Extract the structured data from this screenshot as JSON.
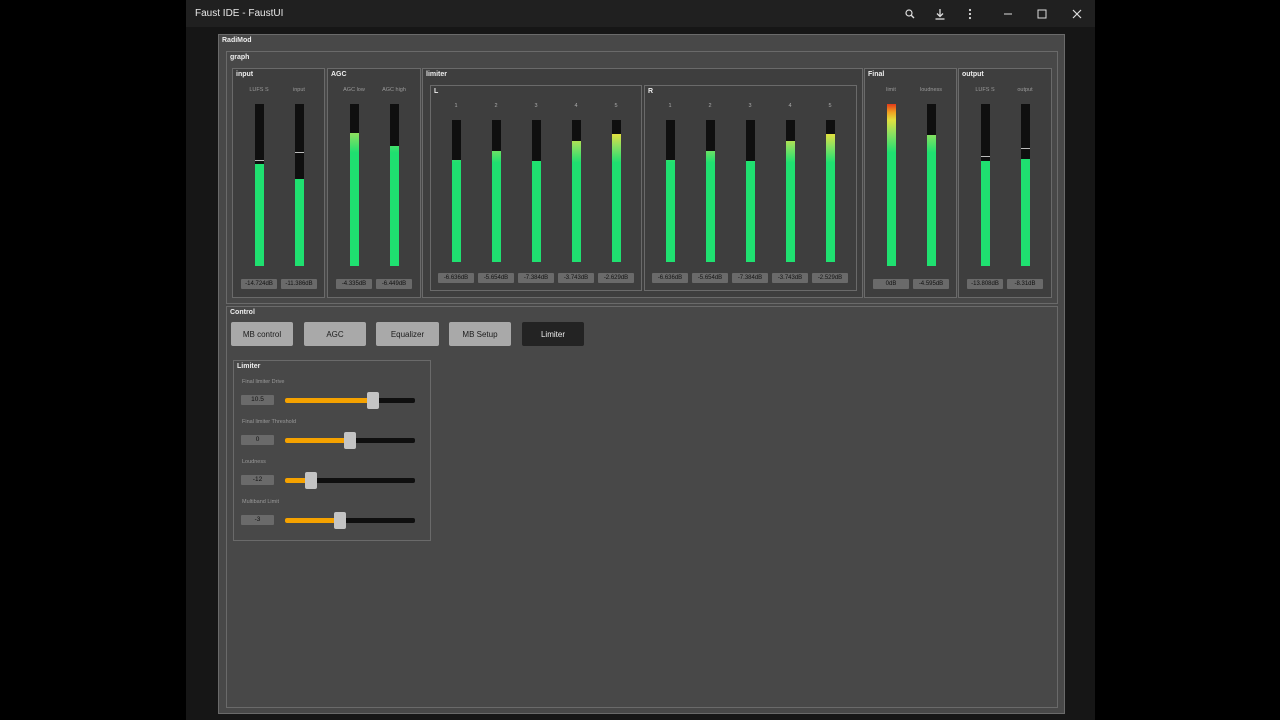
{
  "window": {
    "title": "Faust IDE - FaustUI",
    "buttons": {
      "zoom_icon": "zoom-icon",
      "download_icon": "download-icon",
      "more_icon": "more-icon"
    }
  },
  "app": {
    "name": "RadiMod",
    "graph": {
      "label": "graph",
      "input": {
        "label": "input",
        "meters": [
          {
            "name": "LUFS S",
            "value_text": "-14.724dB",
            "level": 0.63,
            "peak": 0.65
          },
          {
            "name": "input",
            "value_text": "-11.386dB",
            "level": 0.54,
            "peak": 0.7
          }
        ]
      },
      "agc": {
        "label": "AGC",
        "meters": [
          {
            "name": "AGC low",
            "value_text": "-4.335dB",
            "level": 0.82
          },
          {
            "name": "AGC high",
            "value_text": "-6.449dB",
            "level": 0.74
          }
        ]
      },
      "limiter": {
        "label": "limiter",
        "left": {
          "label": "L",
          "channels": [
            "1",
            "2",
            "3",
            "4",
            "5"
          ],
          "values": [
            "-6.636dB",
            "-5.654dB",
            "-7.384dB",
            "-3.743dB",
            "-2.629dB"
          ],
          "levels": [
            0.72,
            0.78,
            0.71,
            0.85,
            0.9
          ]
        },
        "right": {
          "label": "R",
          "channels": [
            "1",
            "2",
            "3",
            "4",
            "5"
          ],
          "values": [
            "-6.636dB",
            "-5.654dB",
            "-7.384dB",
            "-3.743dB",
            "-2.529dB"
          ],
          "levels": [
            0.72,
            0.78,
            0.71,
            0.85,
            0.9
          ]
        }
      },
      "final": {
        "label": "Final",
        "meters": [
          {
            "name": "limit",
            "value_text": "0dB",
            "level": 1.0
          },
          {
            "name": "loudness",
            "value_text": "-4.595dB",
            "level": 0.81
          }
        ]
      },
      "output": {
        "label": "output",
        "meters": [
          {
            "name": "LUFS S",
            "value_text": "-13.808dB",
            "level": 0.65,
            "peak": 0.67
          },
          {
            "name": "output",
            "value_text": "-8.31dB",
            "level": 0.66,
            "peak": 0.72
          }
        ]
      }
    },
    "control": {
      "label": "Control",
      "tabs": [
        "MB control",
        "AGC",
        "Equalizer",
        "MB Setup",
        "Limiter"
      ],
      "active_tab": "Limiter",
      "limiter_panel": {
        "label": "Limiter",
        "sliders": [
          {
            "label": "Final limiter Drive",
            "value": "10.5",
            "fraction": 0.68
          },
          {
            "label": "Final limiter Threshold",
            "value": "0",
            "fraction": 0.5
          },
          {
            "label": "Loudness",
            "value": "-12",
            "fraction": 0.2
          },
          {
            "label": "Multiband Limit",
            "value": "-3",
            "fraction": 0.42
          }
        ]
      }
    }
  },
  "colors": {
    "meter_green": "#1fe070",
    "meter_yellow": "#e0e040",
    "meter_red": "#e23a1a",
    "slider_orange": "#f5a200"
  }
}
